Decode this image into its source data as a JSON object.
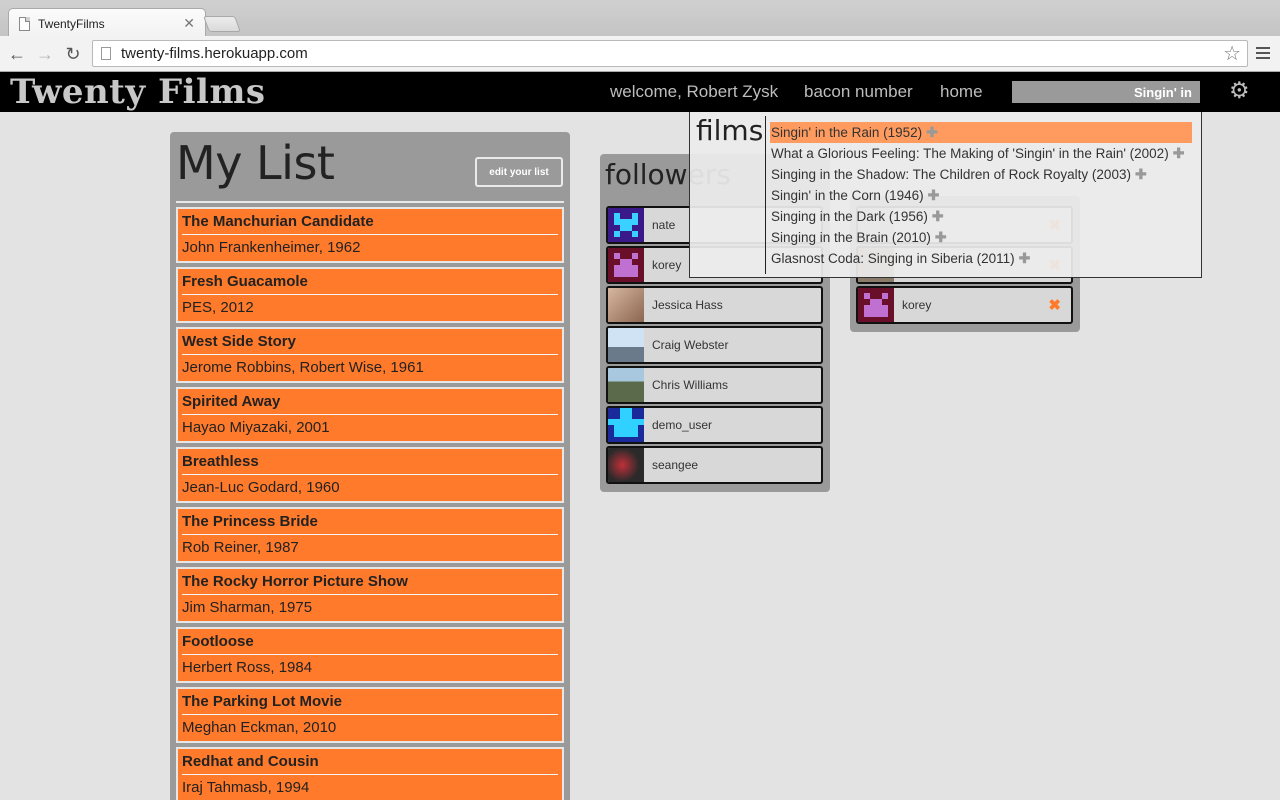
{
  "browser": {
    "tab_title": "TwentyFilms",
    "url": "twenty-films.herokuapp.com"
  },
  "header": {
    "logo": "Twenty Films",
    "welcome": "welcome, Robert Zysk",
    "bacon": "bacon number",
    "home": "home",
    "search_value": "Singin' in"
  },
  "mylist": {
    "title": "My List",
    "edit_label": "edit your list",
    "films": [
      {
        "title": "The Manchurian Candidate",
        "director": "John Frankenheimer, 1962"
      },
      {
        "title": "Fresh Guacamole",
        "director": "PES, 2012"
      },
      {
        "title": "West Side Story",
        "director": "Jerome Robbins, Robert Wise, 1961"
      },
      {
        "title": "Spirited Away",
        "director": "Hayao Miyazaki, 2001"
      },
      {
        "title": "Breathless",
        "director": "Jean-Luc Godard, 1960"
      },
      {
        "title": "The Princess Bride",
        "director": "Rob Reiner, 1987"
      },
      {
        "title": "The Rocky Horror Picture Show",
        "director": "Jim Sharman, 1975"
      },
      {
        "title": "Footloose",
        "director": "Herbert Ross, 1984"
      },
      {
        "title": "The Parking Lot Movie",
        "director": "Meghan Eckman, 2010"
      },
      {
        "title": "Redhat and Cousin",
        "director": "Iraj Tahmasb, 1994"
      }
    ]
  },
  "followers": {
    "title": "followers",
    "users": [
      "nate",
      "korey",
      "Jessica Hass",
      "Craig Webster",
      "Chris Williams",
      "demo_user",
      "seangee"
    ]
  },
  "following": {
    "users": [
      "",
      "",
      "korey"
    ]
  },
  "dropdown": {
    "label": "films",
    "results": [
      "Singin' in the Rain (1952)",
      "What a Glorious Feeling: The Making of 'Singin' in the Rain' (2002)",
      "Singing in the Shadow: The Children of Rock Royalty (2003)",
      "Singin' in the Corn (1946)",
      "Singing in the Dark (1956)",
      "Singing in the Brain (2010)",
      "Glasnost Coda: Singing in Siberia (2011)"
    ]
  },
  "colors": {
    "accent": "#ff7a2a",
    "highlight": "#ff9b5f"
  }
}
